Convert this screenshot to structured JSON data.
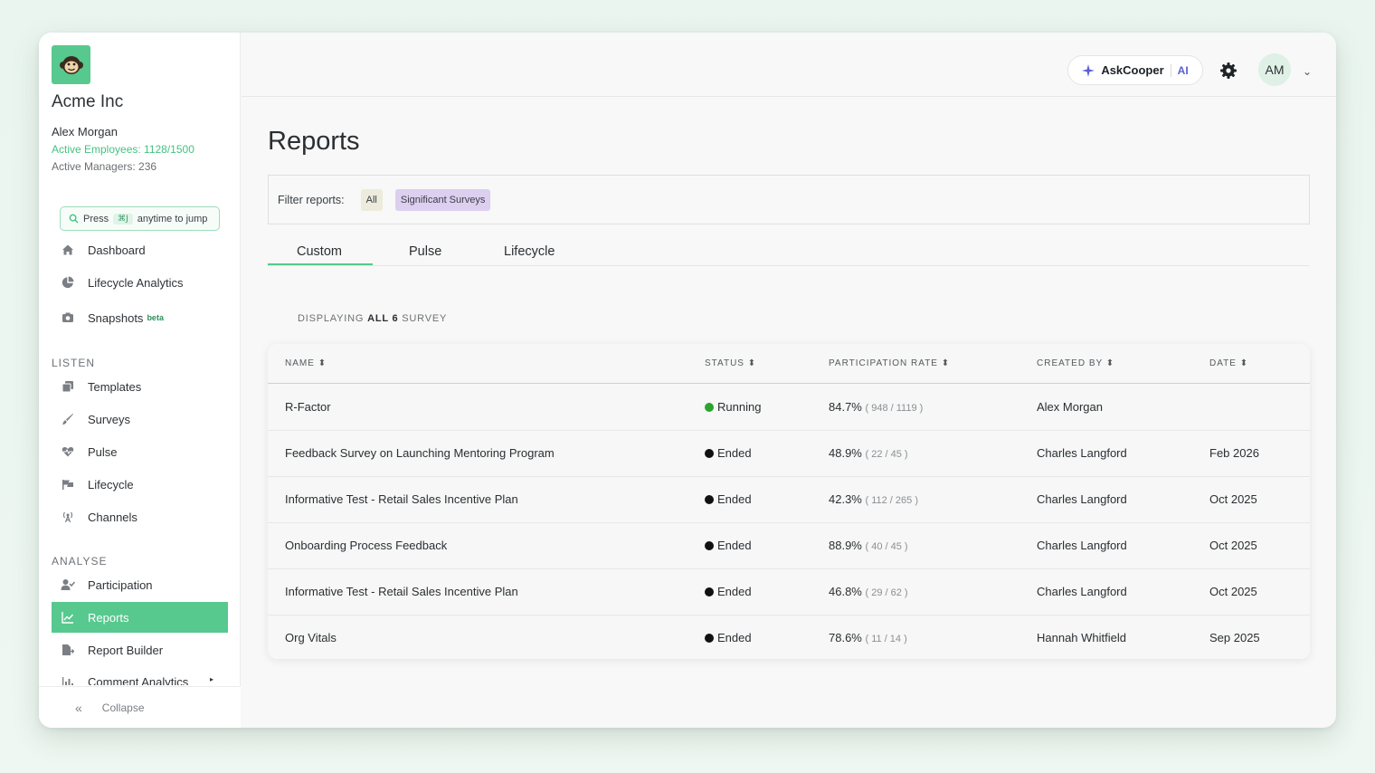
{
  "sidebar": {
    "company": "Acme Inc",
    "user_name": "Alex Morgan",
    "active_employees": "Active Employees: 1128/1500",
    "active_managers": "Active Managers: 236",
    "jump": {
      "press": "Press",
      "shortcut": "⌘J",
      "suffix": "anytime to jump"
    },
    "top_items": [
      {
        "label": "Dashboard",
        "icon": "home-icon"
      },
      {
        "label": "Lifecycle Analytics",
        "icon": "pie-chart-icon"
      },
      {
        "label": "Snapshots",
        "icon": "camera-icon",
        "badge": "beta"
      }
    ],
    "listen_label": "LISTEN",
    "listen_items": [
      {
        "label": "Templates",
        "icon": "copy-icon"
      },
      {
        "label": "Surveys",
        "icon": "brush-icon"
      },
      {
        "label": "Pulse",
        "icon": "heartbeat-icon"
      },
      {
        "label": "Lifecycle",
        "icon": "flag-icon"
      },
      {
        "label": "Channels",
        "icon": "broadcast-icon"
      }
    ],
    "analyse_label": "ANALYSE",
    "analyse_items": [
      {
        "label": "Participation",
        "icon": "user-check-icon"
      },
      {
        "label": "Reports",
        "icon": "line-chart-icon",
        "active": true
      },
      {
        "label": "Report Builder",
        "icon": "file-export-icon"
      },
      {
        "label": "Comment Analytics",
        "icon": "bar-chart-icon"
      }
    ],
    "collapse_label": "Collapse"
  },
  "header": {
    "askcooper_label": "AskCooper",
    "ai_label": "AI",
    "avatar_initials": "AM"
  },
  "main": {
    "title": "Reports",
    "filter_label": "Filter reports:",
    "filter_all": "All",
    "filter_significant": "Significant Surveys",
    "tabs": [
      "Custom",
      "Pulse",
      "Lifecycle"
    ],
    "displaying_prefix": "DISPLAYING",
    "displaying_count": "ALL 6",
    "displaying_suffix": "SURVEY"
  },
  "table": {
    "columns": [
      "NAME",
      "STATUS",
      "PARTICIPATION RATE",
      "CREATED BY",
      "DATE"
    ],
    "rows": [
      {
        "name": "R-Factor",
        "status": "Running",
        "status_color": "#2aa52a",
        "rate": "84.7%",
        "rate_detail": "( 948 / 1119 )",
        "created_by": "Alex Morgan",
        "date": ""
      },
      {
        "name": "Feedback Survey on Launching Mentoring Program",
        "status": "Ended",
        "status_color": "#111111",
        "rate": "48.9%",
        "rate_detail": "( 22 / 45 )",
        "created_by": "Charles Langford",
        "date": "Feb 2026"
      },
      {
        "name": "Informative Test - Retail Sales Incentive Plan",
        "status": "Ended",
        "status_color": "#111111",
        "rate": "42.3%",
        "rate_detail": "( 112 / 265 )",
        "created_by": "Charles Langford",
        "date": "Oct 2025"
      },
      {
        "name": "Onboarding Process Feedback",
        "status": "Ended",
        "status_color": "#111111",
        "rate": "88.9%",
        "rate_detail": "( 40 / 45 )",
        "created_by": "Charles Langford",
        "date": "Oct 2025"
      },
      {
        "name": "Informative Test - Retail Sales Incentive Plan",
        "status": "Ended",
        "status_color": "#111111",
        "rate": "46.8%",
        "rate_detail": "( 29 / 62 )",
        "created_by": "Charles Langford",
        "date": "Oct 2025"
      },
      {
        "name": "Org Vitals",
        "status": "Ended",
        "status_color": "#111111",
        "rate": "78.6%",
        "rate_detail": "( 11 / 14 )",
        "created_by": "Hannah Whitfield",
        "date": "Sep 2025"
      }
    ]
  },
  "colors": {
    "accent": "#57c98e",
    "running": "#2aa52a",
    "ended": "#111111",
    "ai": "#5a5fd6"
  }
}
